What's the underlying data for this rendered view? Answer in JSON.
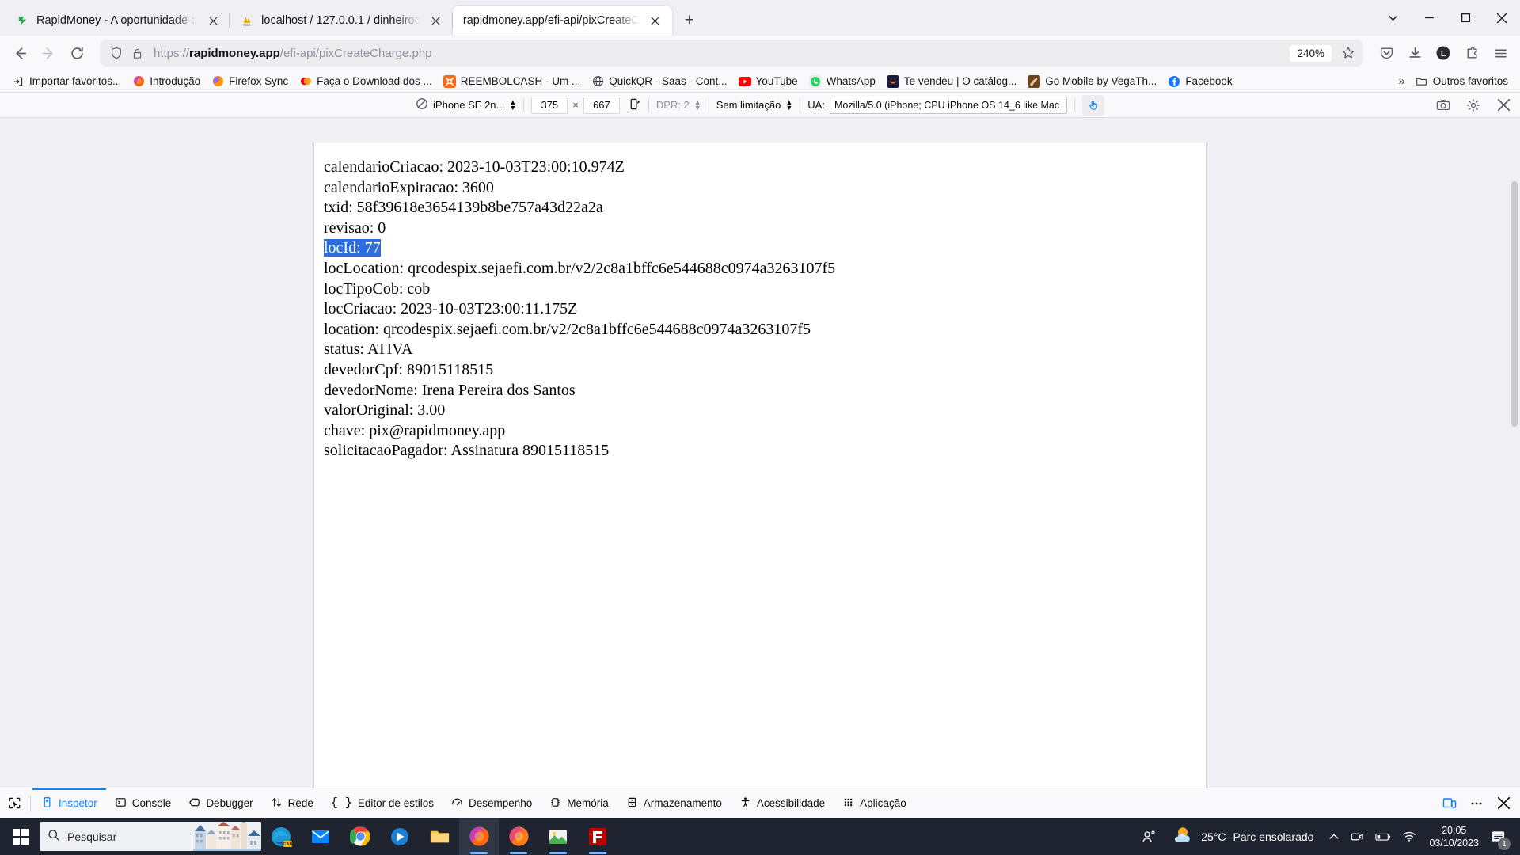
{
  "browser": {
    "tabs": [
      {
        "title": "RapidMoney - A oportunidade d",
        "favicon": "rapidmoney-icon",
        "active": false
      },
      {
        "title": "localhost / 127.0.0.1 / dinheiroc",
        "favicon": "phpmyadmin-icon",
        "active": false
      },
      {
        "title": "rapidmoney.app/efi-api/pixCreateC",
        "favicon": "none",
        "active": true
      }
    ],
    "new_tab_label": "+",
    "window_controls": {
      "list_all_tabs": "chevron-down-icon",
      "minimize": "minimize-icon",
      "maximize": "maximize-icon",
      "close": "close-icon"
    },
    "nav": {
      "back": "back-arrow-icon",
      "forward": "forward-arrow-icon",
      "reload": "reload-icon"
    },
    "url": {
      "scheme": "https://",
      "domain": "rapidmoney.app",
      "path": "/efi-api/pixCreateCharge.php",
      "full": "https://rapidmoney.app/efi-api/pixCreateCharge.php",
      "zoom_level": "240%",
      "shield_icon": "shield-icon",
      "lock_icon": "lock-icon",
      "bookmark_icon": "star-icon"
    },
    "toolbar_right": [
      {
        "name": "pocket-icon"
      },
      {
        "name": "downloads-icon"
      },
      {
        "name": "account-avatar",
        "letter": "L"
      },
      {
        "name": "extensions-icon"
      },
      {
        "name": "app-menu-icon"
      }
    ],
    "bookmarks": [
      {
        "label": "Importar favoritos...",
        "icon": "import-icon"
      },
      {
        "label": "Introdução",
        "icon": "firefox-icon"
      },
      {
        "label": "Firefox Sync",
        "icon": "firefox-sync-icon"
      },
      {
        "label": "Faça o Download dos ...",
        "icon": "mastercard-icon"
      },
      {
        "label": "REEMBOLCASH - Um ...",
        "icon": "reembolcash-icon"
      },
      {
        "label": "QuickQR - Saas - Cont...",
        "icon": "globe-icon"
      },
      {
        "label": "YouTube",
        "icon": "youtube-icon"
      },
      {
        "label": "WhatsApp",
        "icon": "whatsapp-icon"
      },
      {
        "label": "Te vendeu | O catálog...",
        "icon": "tevendeu-icon"
      },
      {
        "label": "Go Mobile by VegaTh...",
        "icon": "gomobile-icon"
      },
      {
        "label": "Facebook",
        "icon": "facebook-icon"
      }
    ],
    "bookmarks_overflow": "»",
    "other_bookmarks": {
      "label": "Outros favoritos",
      "icon": "folder-icon"
    }
  },
  "responsive_mode": {
    "device_icon": "no-device-icon",
    "device": "iPhone SE 2n...",
    "width": "375",
    "times": "×",
    "height": "667",
    "rotate_icon": "rotate-device-icon",
    "dpr_label": "DPR: 2",
    "throttling": "Sem limitação",
    "ua_label": "UA:",
    "ua_value": "Mozilla/5.0 (iPhone; CPU iPhone OS 14_6 like Mac ",
    "touch_simulation_icon": "touch-pointer-icon",
    "camera_icon": "camera-icon",
    "settings_icon": "gear-icon",
    "close_icon": "close-icon"
  },
  "page": {
    "lines": [
      {
        "text": "calendarioCriacao: 2023-10-03T23:00:10.974Z",
        "highlighted": false
      },
      {
        "text": "calendarioExpiracao: 3600",
        "highlighted": false
      },
      {
        "text": "txid: 58f39618e3654139b8be757a43d22a2a",
        "highlighted": false
      },
      {
        "text": "revisao: 0",
        "highlighted": false
      },
      {
        "text": "locId: 77",
        "highlighted": true
      },
      {
        "text": "locLocation: qrcodespix.sejaefi.com.br/v2/2c8a1bffc6e544688c0974a3263107f5",
        "highlighted": false
      },
      {
        "text": "locTipoCob: cob",
        "highlighted": false
      },
      {
        "text": "locCriacao: 2023-10-03T23:00:11.175Z",
        "highlighted": false
      },
      {
        "text": "location: qrcodespix.sejaefi.com.br/v2/2c8a1bffc6e544688c0974a3263107f5",
        "highlighted": false
      },
      {
        "text": "status: ATIVA",
        "highlighted": false
      },
      {
        "text": "devedorCpf: 89015118515",
        "highlighted": false
      },
      {
        "text": "devedorNome: Irena Pereira dos Santos",
        "highlighted": false
      },
      {
        "text": "valorOriginal: 3.00",
        "highlighted": false
      },
      {
        "text": "chave: pix@rapidmoney.app",
        "highlighted": false
      },
      {
        "text": "solicitacaoPagador: Assinatura 89015118515",
        "highlighted": false
      }
    ],
    "selection_color": "#2c6ddb"
  },
  "devtools": {
    "picker_icon": "element-picker-icon",
    "tabs": [
      {
        "label": "Inspetor",
        "icon": "inspector-icon",
        "selected": true
      },
      {
        "label": "Console",
        "icon": "console-icon",
        "selected": false
      },
      {
        "label": "Debugger",
        "icon": "debugger-icon",
        "selected": false
      },
      {
        "label": "Rede",
        "icon": "network-icon",
        "selected": false
      },
      {
        "label": "Editor de estilos",
        "icon": "style-editor-icon",
        "selected": false
      },
      {
        "label": "Desempenho",
        "icon": "performance-icon",
        "selected": false
      },
      {
        "label": "Memória",
        "icon": "memory-icon",
        "selected": false
      },
      {
        "label": "Armazenamento",
        "icon": "storage-icon",
        "selected": false
      },
      {
        "label": "Acessibilidade",
        "icon": "accessibility-icon",
        "selected": false
      },
      {
        "label": "Aplicação",
        "icon": "application-icon",
        "selected": false
      }
    ],
    "right_buttons": [
      {
        "name": "responsive-design-mode-icon",
        "active": true
      },
      {
        "name": "devtools-meatball-menu-icon",
        "active": false
      },
      {
        "name": "devtools-close-icon",
        "active": false
      }
    ],
    "accent_color": "#0a84ff"
  },
  "taskbar": {
    "start_icon": "windows-start-icon",
    "search": {
      "placeholder": "Pesquisar",
      "icon": "search-icon",
      "thumbnail": "frankfurt-buildings-image"
    },
    "pinned": [
      {
        "name": "microsoft-edge-icon",
        "running": false
      },
      {
        "name": "mail-icon",
        "running": false
      },
      {
        "name": "google-chrome-icon",
        "running": false
      },
      {
        "name": "movies-tv-icon",
        "running": false
      },
      {
        "name": "file-explorer-icon",
        "running": false
      },
      {
        "name": "firefox-icon",
        "running": true,
        "active": true
      },
      {
        "name": "firefox-dev-icon",
        "running": true
      },
      {
        "name": "photos-icon",
        "running": true
      },
      {
        "name": "filezilla-icon",
        "running": true
      }
    ],
    "tray": {
      "people_icon": "people-share-icon",
      "weather_icon": "weather-partly-sunny-icon",
      "temperature": "25°C",
      "weather_text": "Parc ensolarado",
      "chevron": "chevron-up-icon",
      "icons": [
        "camera-tray-icon",
        "battery-icon",
        "wifi-icon"
      ],
      "time": "20:05",
      "date": "03/10/2023",
      "notification_icon": "notification-icon",
      "notification_count": "1"
    }
  }
}
